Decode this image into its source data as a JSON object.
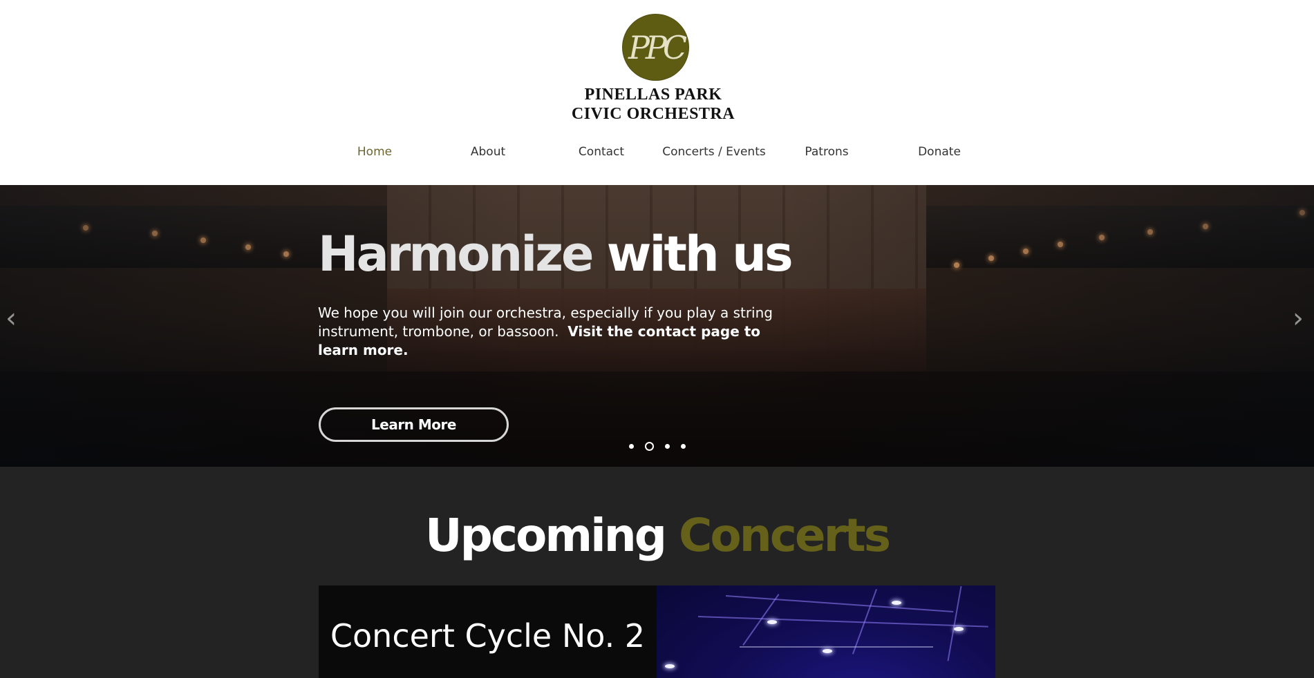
{
  "header": {
    "logo_monogram": "PPC",
    "org_name_line1": "PINELLAS PARK",
    "org_name_line2": "CIVIC ORCHESTRA",
    "nav": [
      {
        "label": "Home",
        "active": true
      },
      {
        "label": "About",
        "active": false
      },
      {
        "label": "Contact",
        "active": false
      },
      {
        "label": "Concerts / Events",
        "active": false
      },
      {
        "label": "Patrons",
        "active": false
      },
      {
        "label": "Donate",
        "active": false
      }
    ]
  },
  "hero": {
    "title_word1": "Harmonize",
    "title_word2": "with us",
    "text_plain": "We hope you will join our orchestra, especially if you play a string instrument, trombone, or bassoon.",
    "text_bold": "Visit the contact page to learn more.",
    "button_label": "Learn More",
    "prev_arrow": "‹",
    "next_arrow": "›",
    "slide_count": 4,
    "active_slide": 2
  },
  "upcoming": {
    "title_word1": "Upcoming",
    "title_word2": "Concerts",
    "card_title": "Concert Cycle No. 2"
  },
  "colors": {
    "brand_olive": "#65611a",
    "nav_active": "#6b6530",
    "section_bg": "#232323"
  },
  "icons": {
    "prev": "chevron-left-icon",
    "next": "chevron-right-icon"
  }
}
